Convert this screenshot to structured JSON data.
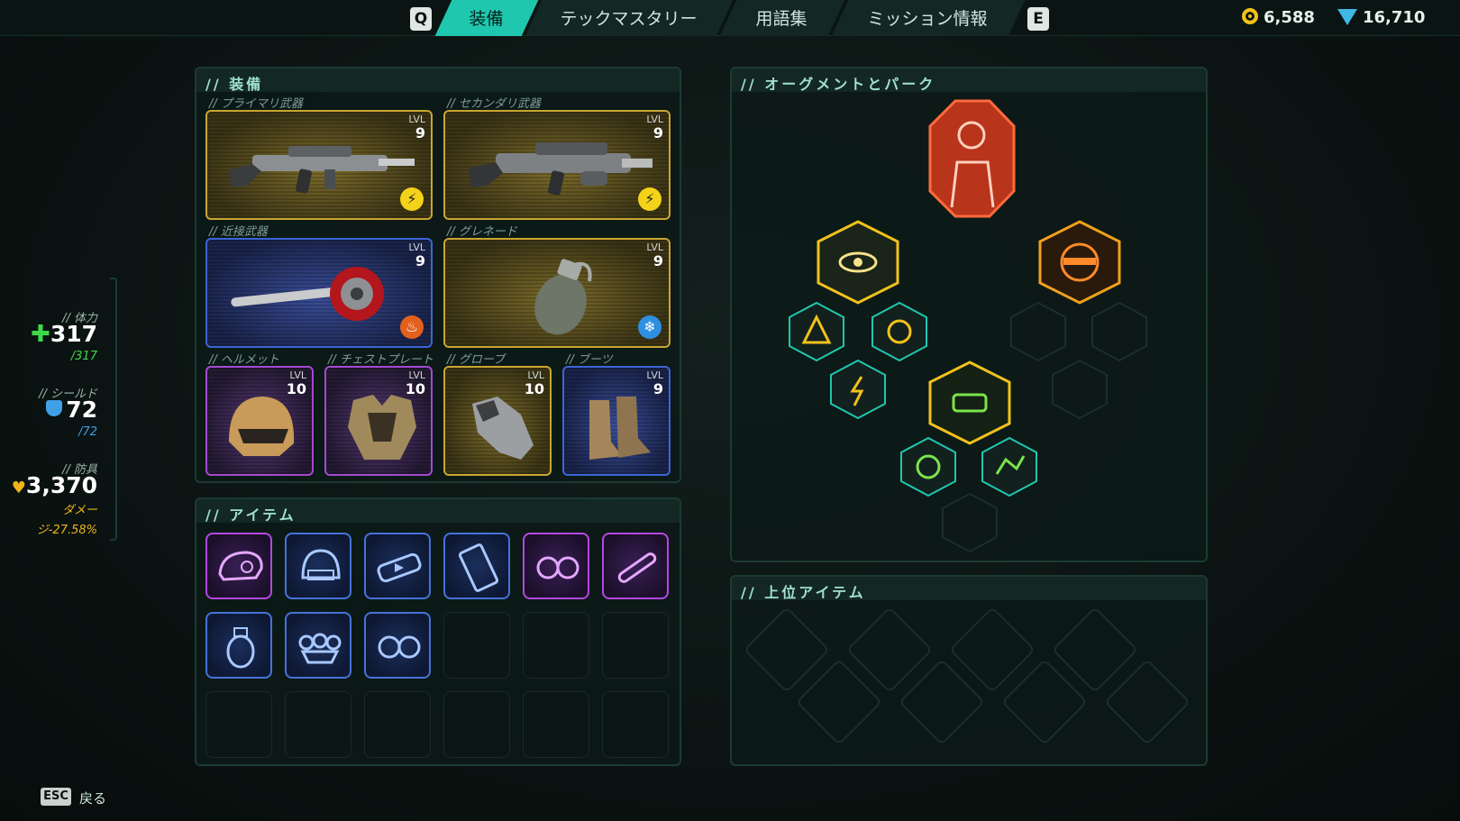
{
  "nav": {
    "prev_key": "Q",
    "next_key": "E",
    "tabs": [
      {
        "label": "装備",
        "active": true
      },
      {
        "label": "テックマスタリー",
        "active": false
      },
      {
        "label": "用語集",
        "active": false
      },
      {
        "label": "ミッション情報",
        "active": false
      }
    ]
  },
  "currency": {
    "coins": "6,588",
    "gems": "16,710",
    "coin_icon": "coin-icon",
    "gem_icon": "gem-icon"
  },
  "stats": {
    "health_label": "// 体力",
    "health_value": "317",
    "health_max": "/317",
    "shield_label": "// シールド",
    "shield_value": "72",
    "shield_max": "/72",
    "armor_label": "// 防具",
    "armor_value": "3,370",
    "armor_sub1": "ダメー",
    "armor_sub2": "ジ-27.58%"
  },
  "equipment": {
    "title": "// 装備",
    "lvl_label": "LVL",
    "slots": [
      {
        "label": "// プライマリ武器",
        "level": "9",
        "rarity": "legendary",
        "element": "lightning-icon"
      },
      {
        "label": "// セカンダリ武器",
        "level": "9",
        "rarity": "legendary",
        "element": "lightning-icon"
      },
      {
        "label": "// 近接武器",
        "level": "9",
        "rarity": "rare",
        "element": "fire-icon"
      },
      {
        "label": "// グレネード",
        "level": "9",
        "rarity": "legendary",
        "element": "frost-icon"
      },
      {
        "label": "// ヘルメット",
        "level": "10",
        "rarity": "epic"
      },
      {
        "label": "// チェストプレート",
        "level": "10",
        "rarity": "epic"
      },
      {
        "label": "// グローブ",
        "level": "10",
        "rarity": "legendary"
      },
      {
        "label": "// ブーツ",
        "level": "9",
        "rarity": "rare"
      }
    ]
  },
  "items": {
    "title": "// アイテム",
    "list": [
      {
        "icon": "beret-icon",
        "rarity": "epic"
      },
      {
        "icon": "helmet-mod-icon",
        "rarity": "rare"
      },
      {
        "icon": "battery-icon",
        "rarity": "rare"
      },
      {
        "icon": "circuit-card-icon",
        "rarity": "rare"
      },
      {
        "icon": "goggles-icon",
        "rarity": "epic"
      },
      {
        "icon": "scope-icon",
        "rarity": "epic"
      },
      {
        "icon": "grenade-icon",
        "rarity": "rare"
      },
      {
        "icon": "brass-knuckles-icon",
        "rarity": "rare"
      },
      {
        "icon": "goggles-icon",
        "rarity": "rare"
      }
    ]
  },
  "augments": {
    "title": "// オーグメントとパーク"
  },
  "top_items": {
    "title": "// 上位アイテム"
  },
  "footer": {
    "esc_key": "ESC",
    "back_label": "戻る"
  },
  "colors": {
    "accent": "#1fc7ae",
    "legendary": "#c9a630",
    "rare": "#3d64d6",
    "epic": "#a44ad0",
    "health": "#3fd84a",
    "shield": "#3fa0e6",
    "armor": "#f1b51b"
  }
}
